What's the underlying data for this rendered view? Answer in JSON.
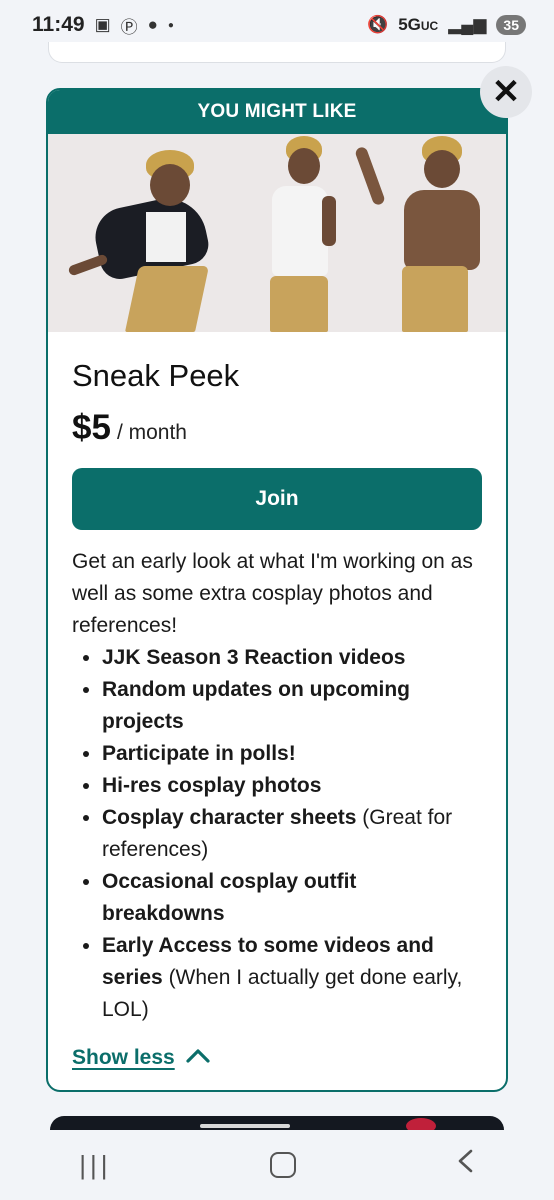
{
  "status_bar": {
    "time": "11:49",
    "network": "5G",
    "network_sub": "UC",
    "battery": "35"
  },
  "card": {
    "header": "YOU MIGHT LIKE",
    "tier_title": "Sneak Peek",
    "price": "$5",
    "period": "/ month",
    "join_label": "Join",
    "description": "Get an early look at what I'm working on as well as some extra cosplay photos and references!",
    "perks": [
      {
        "bold": "JJK Season 3 Reaction videos",
        "rest": ""
      },
      {
        "bold": "Random updates on upcoming projects",
        "rest": ""
      },
      {
        "bold": "Participate in polls!",
        "rest": ""
      },
      {
        "bold": "Hi-res cosplay photos",
        "rest": ""
      },
      {
        "bold": "Cosplay character sheets",
        "rest": " (Great for references)"
      },
      {
        "bold": "Occasional cosplay outfit breakdowns",
        "rest": ""
      },
      {
        "bold": "Early Access to some videos and series",
        "rest": " (When I actually get done early, LOL)"
      }
    ],
    "show_less_label": "Show less"
  },
  "colors": {
    "accent": "#0b6e6a",
    "background": "#f2f4f8"
  },
  "icons": {
    "close": "close-icon",
    "chevron": "chevron-up-icon"
  }
}
